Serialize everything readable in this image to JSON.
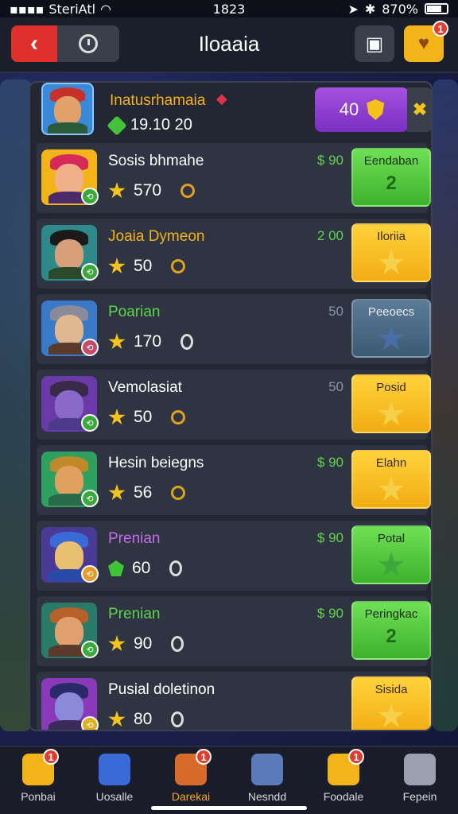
{
  "status_bar": {
    "carrier": "SteriAtl",
    "time": "1823",
    "battery": "870%"
  },
  "header": {
    "title": "Iloaaia"
  },
  "notifications": {
    "gift_count": "1"
  },
  "player": {
    "name": "Inatusrhamaia",
    "score": "19.10 20",
    "level": "40"
  },
  "rows": [
    {
      "name": "Sosis bhmahe",
      "name_color": "#ffffff",
      "score": "570",
      "price": "$ 90",
      "price_color": "#5fd44a",
      "action_label": "Eendaban",
      "action_value": "2",
      "action_style": "green"
    },
    {
      "name": "Joaia Dymeon",
      "name_color": "#f4b21a",
      "score": "50",
      "price": "2 00",
      "price_color": "#5fd44a",
      "action_label": "Iloriia",
      "action_value": "",
      "action_style": "yellow"
    },
    {
      "name": "Poarian",
      "name_color": "#5fd44a",
      "score": "170",
      "price": "50",
      "price_color": "#8a93a6",
      "action_label": "Peeoecs",
      "action_value": "",
      "action_style": "blue"
    },
    {
      "name": "Vemolasiat",
      "name_color": "#ffffff",
      "score": "50",
      "price": "50",
      "price_color": "#8a93a6",
      "action_label": "Posid",
      "action_value": "",
      "action_style": "yellow"
    },
    {
      "name": "Hesin beiegns",
      "name_color": "#ffffff",
      "score": "56",
      "price": "$ 90",
      "price_color": "#5fd44a",
      "action_label": "Elahn",
      "action_value": "",
      "action_style": "yellow"
    },
    {
      "name": "Prenian",
      "name_color": "#c56ae8",
      "score": "60",
      "price": "$ 90",
      "price_color": "#5fd44a",
      "action_label": "Potal",
      "action_value": "",
      "action_style": "green"
    },
    {
      "name": "Prenian",
      "name_color": "#5fd44a",
      "score": "90",
      "price": "$ 90",
      "price_color": "#5fd44a",
      "action_label": "Peringkac",
      "action_value": "2",
      "action_style": "green"
    },
    {
      "name": "Pusial doletinon",
      "name_color": "#ffffff",
      "score": "80",
      "price": "",
      "price_color": "#5fd44a",
      "action_label": "Sisida",
      "action_value": "",
      "action_style": "yellow"
    }
  ],
  "nav": [
    {
      "label": "Ponbai",
      "icon": "home-icon",
      "badge": "1"
    },
    {
      "label": "Uosalle",
      "icon": "shield-icon",
      "badge": ""
    },
    {
      "label": "Darekai",
      "icon": "treasure-chest-icon",
      "badge": "1"
    },
    {
      "label": "Nesndd",
      "icon": "profile-icon",
      "badge": ""
    },
    {
      "label": "Foodale",
      "icon": "star-icon",
      "badge": "1"
    },
    {
      "label": "Fepein",
      "icon": "ghost-icon",
      "badge": ""
    }
  ]
}
